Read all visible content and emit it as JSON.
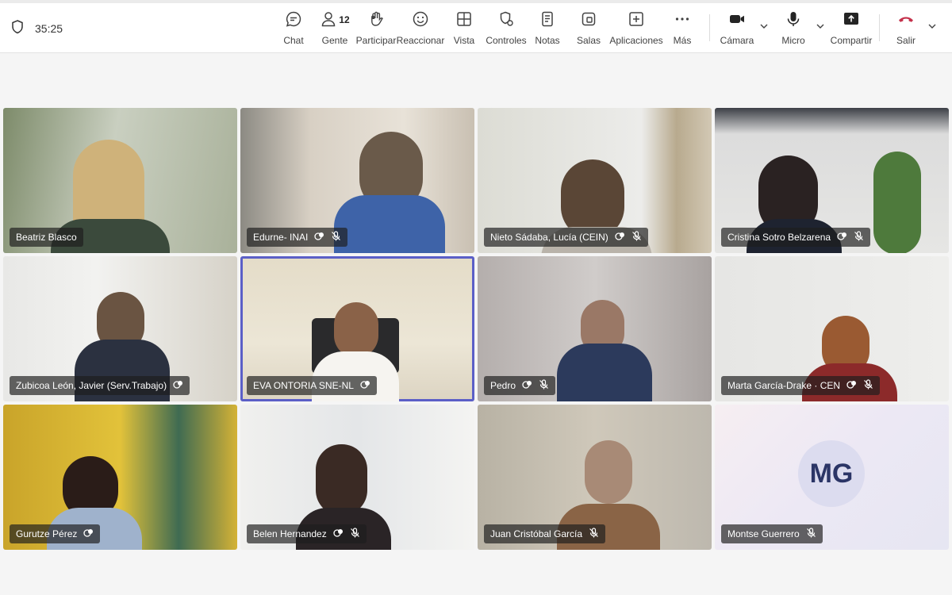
{
  "meeting": {
    "elapsed_time": "35:25"
  },
  "toolbar": {
    "chat": "Chat",
    "people": "Gente",
    "people_count": "12",
    "raise": "Participar",
    "react": "Reaccionar",
    "view": "Vista",
    "controls": "Controles",
    "notes": "Notas",
    "rooms": "Salas",
    "apps": "Aplicaciones",
    "more": "Más",
    "camera": "Cámara",
    "mic": "Micro",
    "share": "Compartir",
    "leave": "Salir"
  },
  "colors": {
    "accent": "#5b5fc7",
    "leave": "#c4314b",
    "bg": "#f5f5f5"
  },
  "participants": [
    {
      "name": "Beatriz Blasco",
      "icons": []
    },
    {
      "name": "Edurne- INAI",
      "icons": [
        "reaction-icon",
        "mic-off-icon"
      ]
    },
    {
      "name": "Nieto Sádaba, Lucía (CEIN)",
      "icons": [
        "reaction-icon",
        "mic-off-icon"
      ]
    },
    {
      "name": "Cristina Sotro Belzarena",
      "icons": [
        "reaction-icon",
        "mic-off-icon"
      ]
    },
    {
      "name": "Zubicoa León, Javier (Serv.Trabajo)",
      "icons": [
        "reaction-icon"
      ]
    },
    {
      "name": "EVA ONTORIA SNE-NL",
      "icons": [
        "reaction-icon"
      ],
      "active_speaker": true
    },
    {
      "name": "Pedro",
      "icons": [
        "reaction-icon",
        "mic-off-icon"
      ]
    },
    {
      "name": "Marta García-Drake · CEN",
      "icons": [
        "reaction-icon",
        "mic-off-icon"
      ]
    },
    {
      "name": "Gurutze Pérez",
      "icons": [
        "reaction-icon"
      ]
    },
    {
      "name": "Belen Hernandez",
      "icons": [
        "reaction-icon",
        "mic-off-icon"
      ]
    },
    {
      "name": "Juan Cristóbal García",
      "icons": [
        "mic-off-icon"
      ]
    },
    {
      "name": "Montse Guerrero",
      "icons": [
        "mic-off-icon"
      ],
      "initials": "MG"
    }
  ]
}
